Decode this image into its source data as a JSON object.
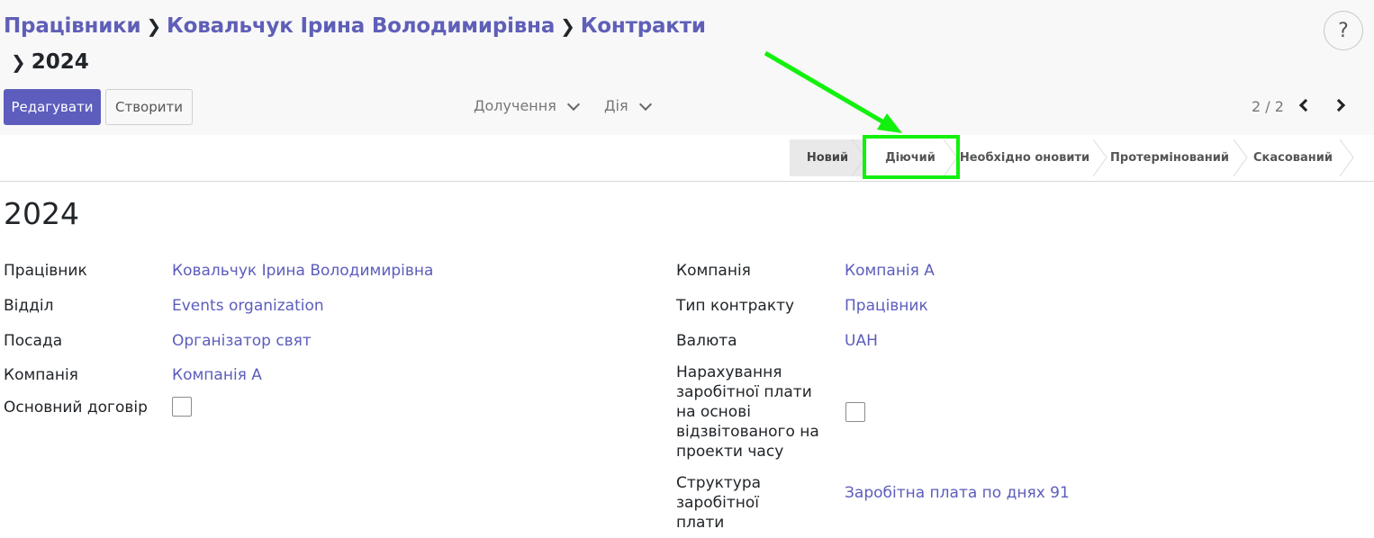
{
  "breadcrumb": {
    "items": [
      "Працівники",
      "Ковальчук Ірина Володимирівна",
      "Контракти"
    ],
    "current": "2024"
  },
  "help_label": "?",
  "toolbar": {
    "edit_label": "Редагувати",
    "create_label": "Створити",
    "attachments_label": "Долучення",
    "action_label": "Дія",
    "pager": "2 / 2"
  },
  "stages": [
    "Новий",
    "Діючий",
    "Необхідно оновити",
    "Протермінований",
    "Скасований"
  ],
  "active_stage": "Новий",
  "highlight_color": "#12f10d",
  "record": {
    "title": "2024",
    "left": {
      "employee_label": "Працівник",
      "employee_value": "Ковальчук Ірина Володимирівна",
      "department_label": "Відділ",
      "department_value": "Events organization",
      "job_label": "Посада",
      "job_value": "Організатор свят",
      "company_label": "Компанія",
      "company_value": "Компанія А",
      "main_contract_label": "Основний договір"
    },
    "right": {
      "company_label": "Компанія",
      "company_value": "Компанія А",
      "contract_type_label": "Тип контракту",
      "contract_type_value": "Працівник",
      "currency_label": "Валюта",
      "currency_value": "UAH",
      "timesheet_label": "Нарахування заробітної плати на основі відзвітованого на проекти часу",
      "structure_label": "Структура заробітної плати",
      "structure_value": "Заробітна плата по днях 91"
    }
  }
}
